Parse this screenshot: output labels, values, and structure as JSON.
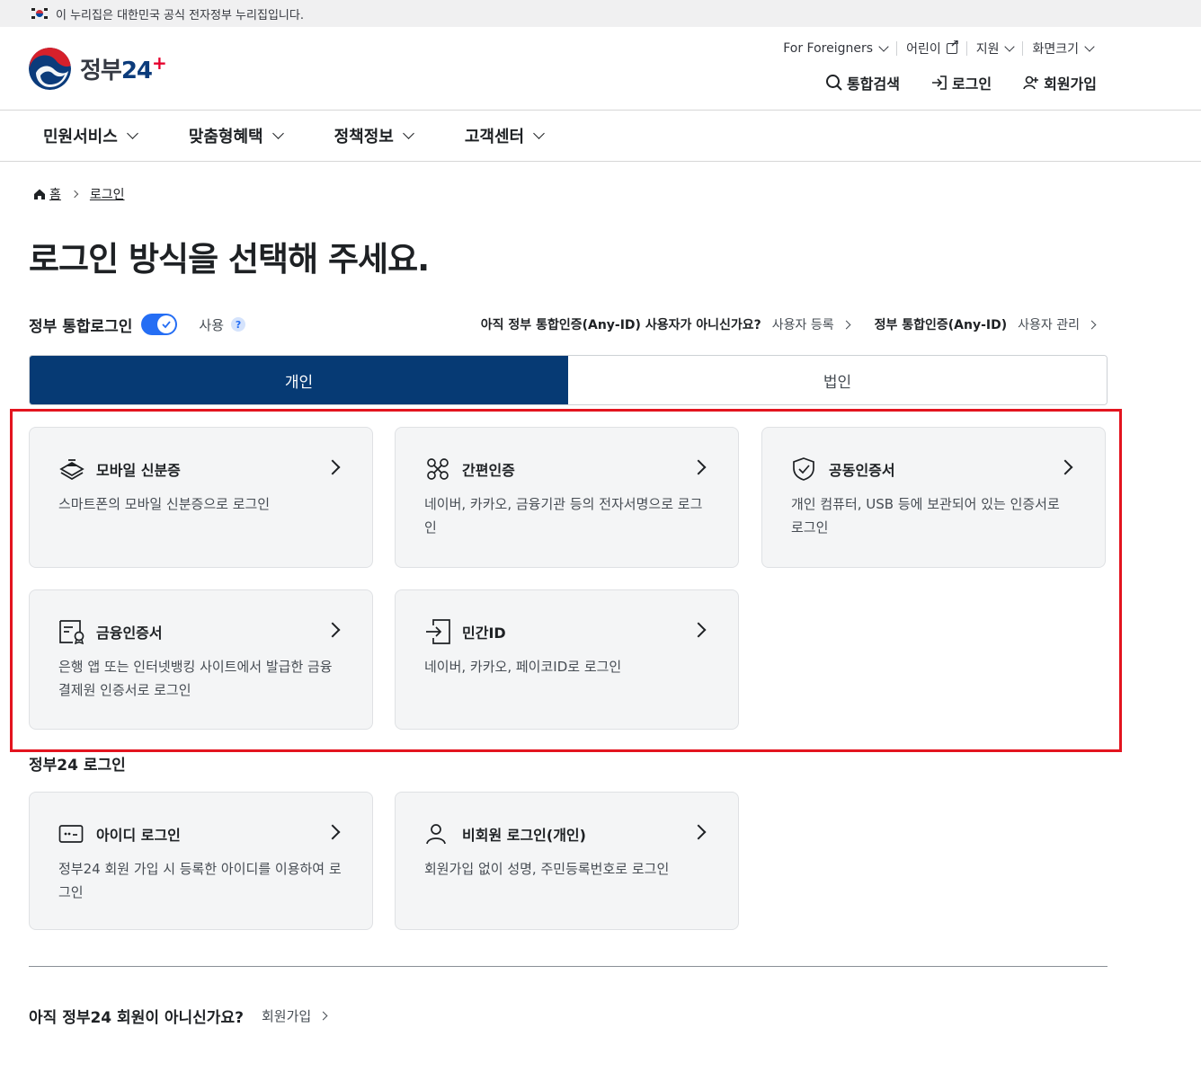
{
  "banner": {
    "text": "이 누리집은 대한민국 공식 전자정부 누리집입니다."
  },
  "logo": {
    "text_kr": "정부",
    "text_num": "24",
    "text_plus": "+"
  },
  "util": [
    {
      "label": "For Foreigners",
      "type": "dropdown"
    },
    {
      "label": "어린이",
      "type": "external"
    },
    {
      "label": "지원",
      "type": "dropdown"
    },
    {
      "label": "화면크기",
      "type": "dropdown"
    }
  ],
  "main_links": {
    "search": "통합검색",
    "login": "로그인",
    "signup": "회원가입"
  },
  "gnb": [
    "민원서비스",
    "맞춤형혜택",
    "정책정보",
    "고객센터"
  ],
  "breadcrumb": {
    "home": "홈",
    "current": "로그인"
  },
  "page_title": "로그인 방식을 선택해 주세요.",
  "integ": {
    "label": "정부 통합로그인",
    "use": "사용",
    "help": "?",
    "q1": "아직 정부 통합인증(Any-ID) 사용자가 아니신가요?",
    "l1": "사용자 등록",
    "q2": "정부 통합인증(Any-ID)",
    "l2": "사용자 관리"
  },
  "tabs": {
    "personal": "개인",
    "corporate": "법인"
  },
  "cards": {
    "mobile_id": {
      "title": "모바일 신분증",
      "desc": "스마트폰의 모바일 신분증으로 로그인"
    },
    "simple_auth": {
      "title": "간편인증",
      "desc": "네이버, 카카오, 금융기관 등의 전자서명으로 로그인"
    },
    "joint_cert": {
      "title": "공동인증서",
      "desc": "개인 컴퓨터, USB 등에 보관되어 있는 인증서로 로그인"
    },
    "finance_cert": {
      "title": "금융인증서",
      "desc": "은행 앱 또는 인터넷뱅킹 사이트에서 발급한 금융결제원 인증서로 로그인"
    },
    "private_id": {
      "title": "민간ID",
      "desc": "네이버, 카카오, 페이코ID로 로그인"
    },
    "id_login": {
      "title": "아이디 로그인",
      "desc": "정부24 회원 가입 시 등록한 아이디를 이용하여 로그인"
    },
    "guest_login": {
      "title": "비회원 로그인(개인)",
      "desc": "회원가입 없이 성명, 주민등록번호로 로그인"
    }
  },
  "gov24_section": {
    "title": "정부24 로그인"
  },
  "bottom": {
    "question": "아직 정부24 회원이 아니신가요?",
    "join": "회원가입"
  },
  "colors": {
    "primary": "#063a74",
    "toggle": "#256ef4",
    "highlight": "#e3141f"
  }
}
